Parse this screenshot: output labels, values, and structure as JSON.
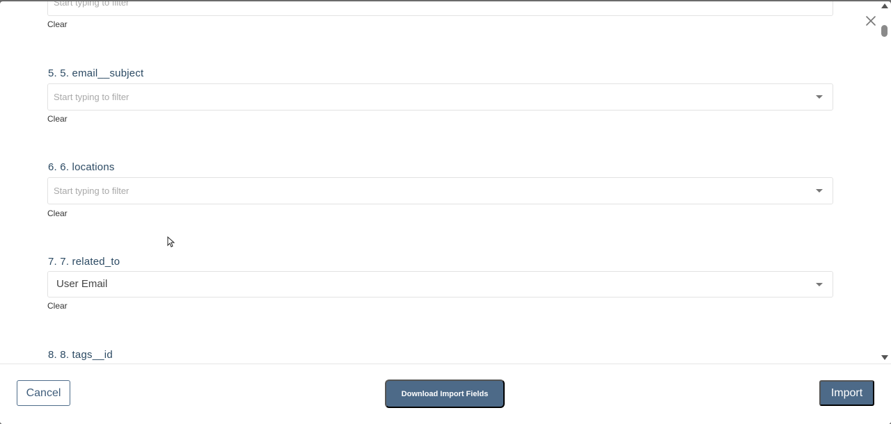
{
  "fields": [
    {
      "label": "",
      "placeholder": "Start typing to filter",
      "value": "",
      "clear_label": "Clear"
    },
    {
      "label": "5. 5. email__subject",
      "placeholder": "Start typing to filter",
      "value": "",
      "clear_label": "Clear"
    },
    {
      "label": "6. 6. locations",
      "placeholder": "Start typing to filter",
      "value": "",
      "clear_label": "Clear"
    },
    {
      "label": "7. 7. related_to",
      "placeholder": "",
      "value": "User Email",
      "clear_label": "Clear"
    },
    {
      "label": "8. 8. tags__id"
    }
  ],
  "footer": {
    "cancel_label": "Cancel",
    "download_label": "Download Import Fields",
    "import_label": "Import"
  },
  "icons": {
    "close": "close-icon",
    "dropdown": "chevron-down-icon"
  }
}
